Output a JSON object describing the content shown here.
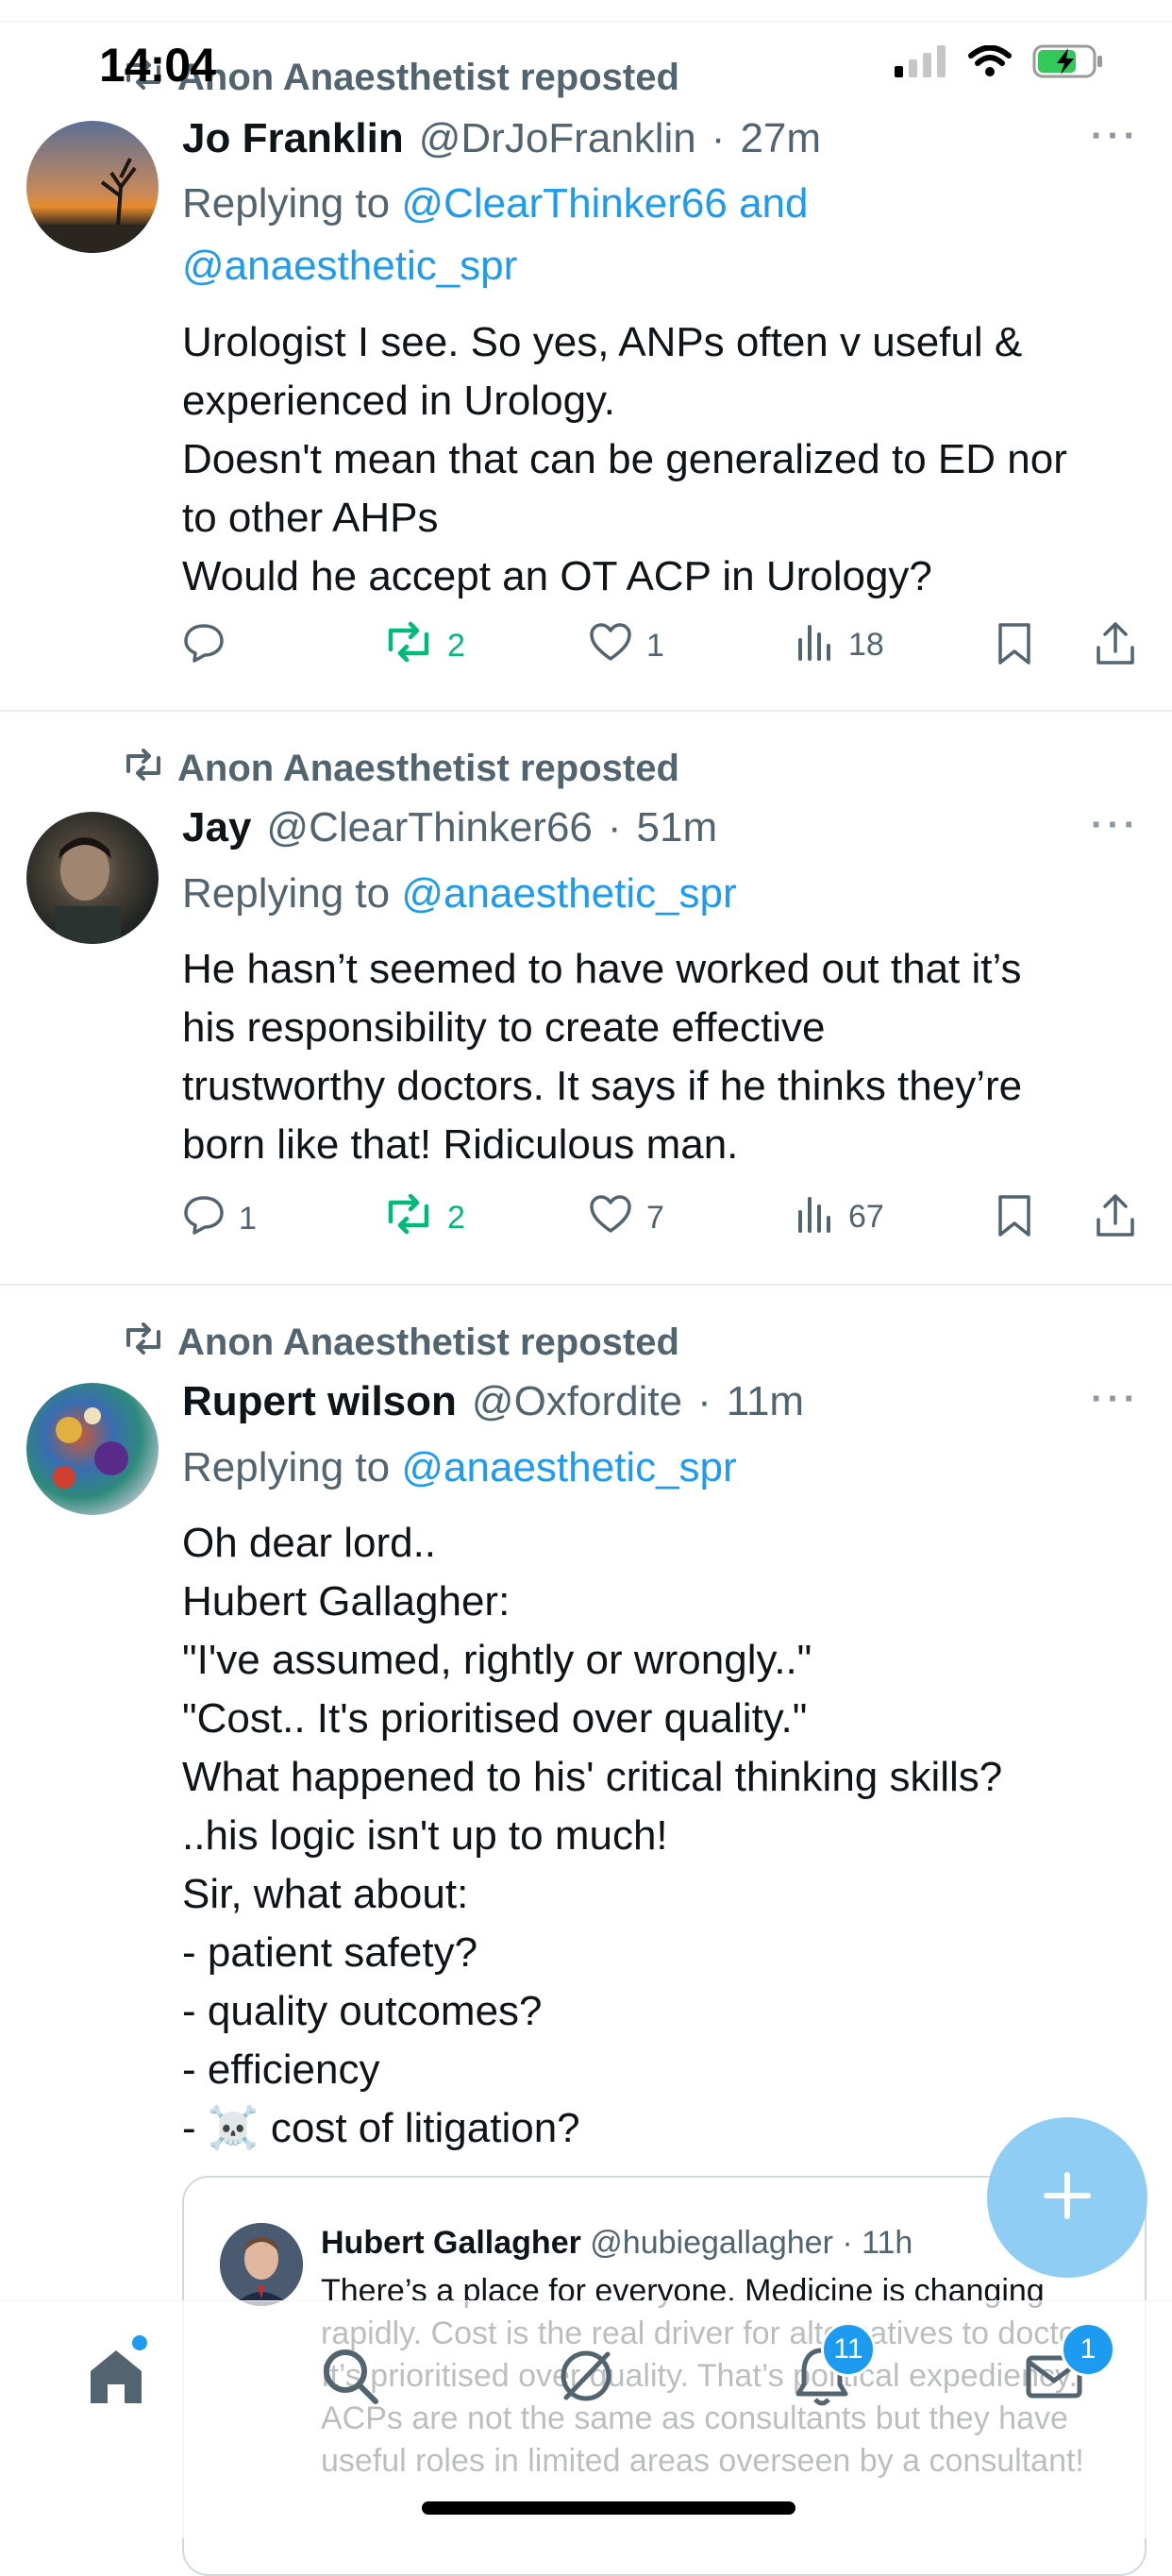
{
  "status_bar": {
    "time": "14:04"
  },
  "tweets": [
    {
      "repost_label": "Anon Anaesthetist reposted",
      "name": "Jo Franklin",
      "handle": "@DrJoFranklin",
      "time": "27m",
      "replying_prefix": "Replying to",
      "replying_to": "@ClearThinker66 and @anaesthetic_spr",
      "lines": [
        "Urologist I see. So yes, ANPs often v useful &",
        "experienced in Urology.",
        "Doesn't mean that can be generalized to ED nor",
        "to other AHPs",
        "Would he accept an OT ACP in Urology?"
      ],
      "replies": "",
      "reposts": "2",
      "likes": "1",
      "views": "18"
    },
    {
      "repost_label": "Anon Anaesthetist reposted",
      "name": "Jay",
      "handle": "@ClearThinker66",
      "time": "51m",
      "replying_prefix": "Replying to",
      "replying_to": "@anaesthetic_spr",
      "lines": [
        "He hasn’t seemed to have worked out that it’s",
        "his responsibility to create effective",
        "trustworthy doctors. It says if he thinks they’re",
        "born like that! Ridiculous man."
      ],
      "replies": "1",
      "reposts": "2",
      "likes": "7",
      "views": "67"
    },
    {
      "repost_label": "Anon Anaesthetist reposted",
      "name": "Rupert wilson",
      "handle": "@Oxfordite",
      "time": "11m",
      "replying_prefix": "Replying to",
      "replying_to": "@anaesthetic_spr",
      "lines": [
        "Oh dear lord..",
        "Hubert Gallagher:",
        "\"I've assumed, rightly or wrongly..\"",
        "\"Cost.. It's prioritised over quality.\"",
        "What happened to his' critical thinking skills?",
        "..his logic isn't up to much!",
        "Sir, what about:",
        "- patient safety?",
        "- quality outcomes?",
        "- efficiency",
        "- ☠️ cost of litigation?"
      ]
    }
  ],
  "quote": {
    "name": "Hubert Gallagher",
    "handle": "@hubiegallagher",
    "time": "11h",
    "text": "There’s a place for everyone. Medicine is changing rapidly. Cost is the real driver for alternatives to doctors.  It’s prioritised over quality. That’s political expediency. ACPs are not the same as consultants but they have useful roles in limited areas overseen by a consultant!"
  },
  "tab_bar": {
    "notifications_badge": "11",
    "messages_badge": "1"
  },
  "colors": {
    "accent": "#1d9bf0",
    "repost_green": "#00ba7c",
    "secondary_text": "#536471"
  }
}
